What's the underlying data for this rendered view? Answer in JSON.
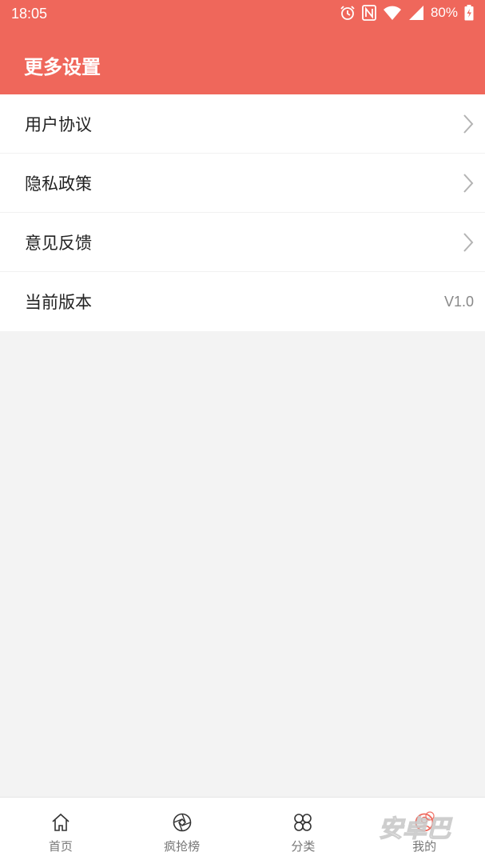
{
  "status_bar": {
    "time": "18:05",
    "battery": "80%",
    "icons": [
      "alarm-icon",
      "nfc-icon",
      "wifi-icon",
      "signal-icon",
      "battery-icon"
    ]
  },
  "header": {
    "title": "更多设置",
    "background_color": "#ef675b"
  },
  "menu": {
    "items": [
      {
        "label": "用户协议",
        "icon": "chevron-right-icon"
      },
      {
        "label": "隐私政策",
        "icon": "chevron-right-icon"
      },
      {
        "label": "意见反馈",
        "icon": "chevron-right-icon"
      },
      {
        "label": "当前版本",
        "value": "V1.0"
      }
    ]
  },
  "tabbar": {
    "tabs": [
      {
        "label": "首页",
        "icon": "home-icon"
      },
      {
        "label": "疯抢榜",
        "icon": "aperture-icon"
      },
      {
        "label": "分类",
        "icon": "category-icon"
      },
      {
        "label": "我的",
        "icon": "user-icon"
      }
    ]
  },
  "watermark": {
    "text": "安卓巴"
  }
}
